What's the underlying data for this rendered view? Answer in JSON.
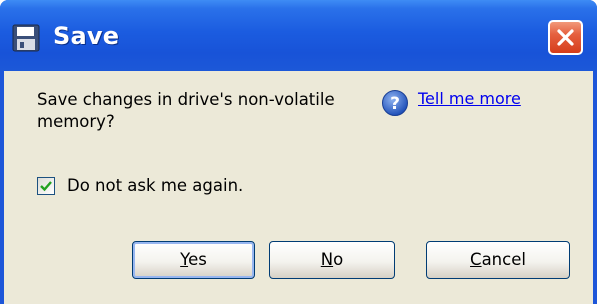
{
  "window": {
    "title": "Save",
    "icon": "floppy-disk-icon",
    "close_icon": "close-icon"
  },
  "dialog": {
    "message": "Save changes in drive's non-volatile memory?",
    "help_icon": "help-question-icon",
    "help_link": "Tell me more",
    "checkbox": {
      "label": "Do not ask me again.",
      "checked": true
    }
  },
  "buttons": {
    "yes": {
      "mnemonic": "Y",
      "rest": "es"
    },
    "no": {
      "mnemonic": "N",
      "rest": "o"
    },
    "cancel": {
      "mnemonic": "C",
      "rest": "ancel"
    }
  },
  "colors": {
    "titlebar": "#1853d8",
    "client_bg": "#ece9d8",
    "link": "#0000ee",
    "close_button": "#d63d1b",
    "checkmark": "#21a121"
  }
}
